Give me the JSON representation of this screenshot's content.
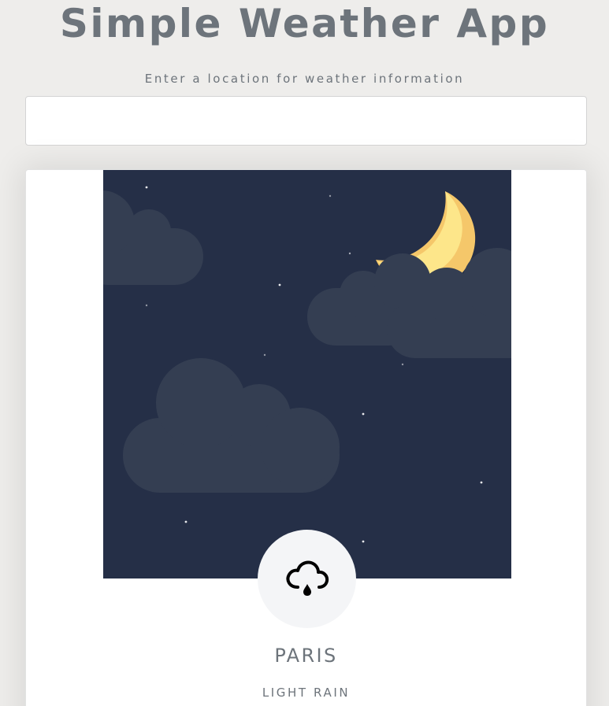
{
  "app": {
    "title": "Simple Weather App"
  },
  "search": {
    "label": "Enter a location for weather information",
    "value": "",
    "placeholder": ""
  },
  "weather": {
    "city": "PARIS",
    "condition": "LIGHT RAIN",
    "icon": "cloud-rain-icon",
    "scene": "night-sky-moon-clouds"
  },
  "colors": {
    "background": "#eeedeb",
    "text": "#6d747b",
    "sky": "#252f47",
    "cloud": "#343e52",
    "moon": "#fde68a",
    "moon_shadow": "#f5c76a"
  }
}
